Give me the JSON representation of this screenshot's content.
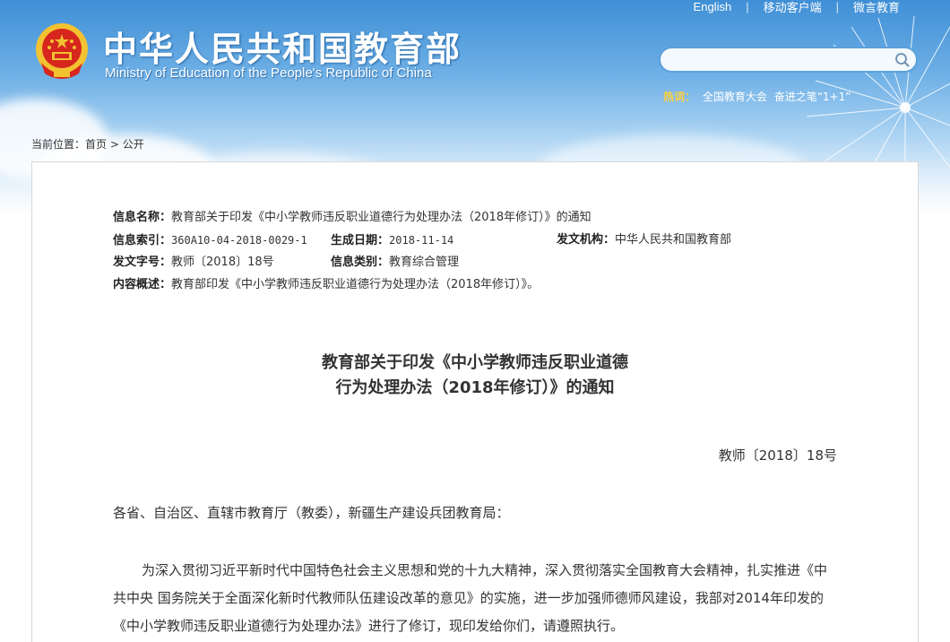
{
  "header": {
    "top_links": [
      "English",
      "移动客户端",
      "微言教育"
    ],
    "site_title": "中华人民共和国教育部",
    "site_subtitle": "Ministry of Education of the People's Republic of China",
    "search_placeholder": "",
    "hot_label": "热词：",
    "hot_items": [
      "全国教育大会",
      "奋进之笔“1+1”"
    ]
  },
  "breadcrumb": {
    "prefix": "当前位置：",
    "home": "首页",
    "separator": ">",
    "current": "公开"
  },
  "meta": {
    "name_label": "信息名称：",
    "name_value": "教育部关于印发《中小学教师违反职业道德行为处理办法（2018年修订）》的通知",
    "index_label": "信息索引：",
    "index_value": "360A10-04-2018-0029-1",
    "date_label": "生成日期：",
    "date_value": "2018-11-14",
    "org_label": "发文机构：",
    "org_value": "中华人民共和国教育部",
    "docno_label": "发文字号：",
    "docno_value": "教师〔2018〕18号",
    "category_label": "信息类别：",
    "category_value": "教育综合管理",
    "summary_label": "内容概述：",
    "summary_value": "教育部印发《中小学教师违反职业道德行为处理办法（2018年修订）》。"
  },
  "document": {
    "title_line1": "教育部关于印发《中小学教师违反职业道德",
    "title_line2": "行为处理办法（2018年修订）》的通知",
    "doc_number": "教师〔2018〕18号",
    "salutation": "各省、自治区、直辖市教育厅（教委），新疆生产建设兵团教育局：",
    "paragraph1": "为深入贯彻习近平新时代中国特色社会主义思想和党的十九大精神，深入贯彻落实全国教育大会精神，扎实推进《中共中央 国务院关于全面深化新时代教师队伍建设改革的意见》的实施，进一步加强师德师风建设，我部对2014年印发的《中小学教师违反职业道德行为处理办法》进行了修订，现印发给你们，请遵照执行。"
  },
  "colors": {
    "sky_top": "#3f8fd6",
    "hot_label": "#ffd13b",
    "emblem_red": "#d7261e",
    "emblem_gold": "#f2c230"
  },
  "icons": {
    "emblem": "national-emblem-icon",
    "search": "search-icon"
  }
}
